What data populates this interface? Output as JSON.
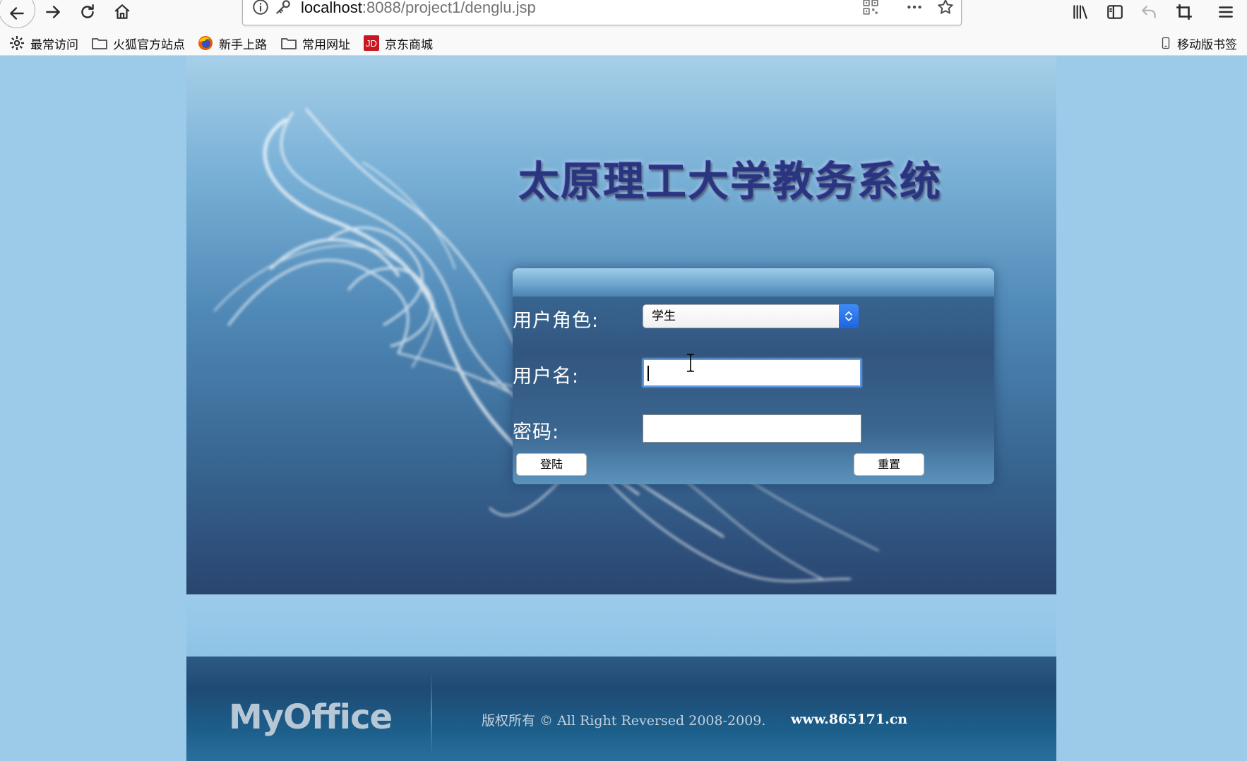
{
  "browser": {
    "url_host": "localhost",
    "url_rest": ":8088/project1/denglu.jsp",
    "bookmarks": [
      "最常访问",
      "火狐官方站点",
      "新手上路",
      "常用网址",
      "京东商城"
    ],
    "mobile_bookmarks": "移动版书签"
  },
  "page": {
    "system_title": "太原理工大学教务系统",
    "form": {
      "role_label": "用户角色:",
      "role_value": "学生",
      "username_label": "用户名:",
      "username_value": "",
      "password_label": "密码:",
      "password_value": "",
      "login_button": "登陆",
      "reset_button": "重置"
    },
    "footer": {
      "logo": "MyOffice",
      "copyright": "版权所有 © All Right Reversed 2008-2009.",
      "site": "www.865171.cn"
    }
  }
}
